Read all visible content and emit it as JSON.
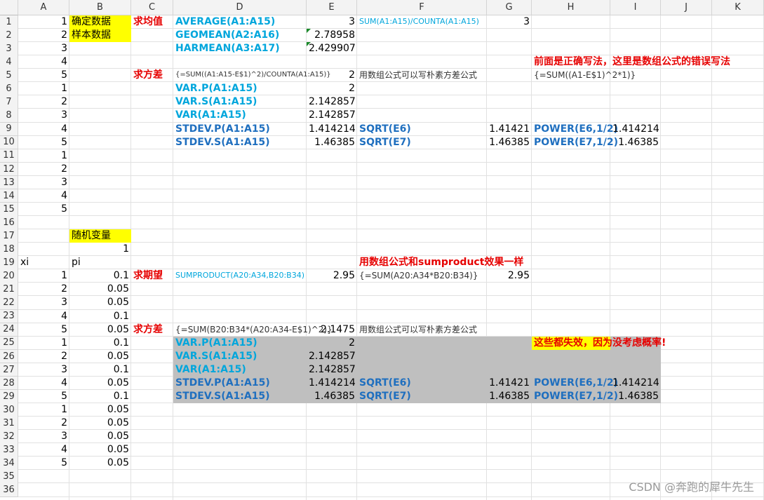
{
  "sheet": {
    "columns": [
      "A",
      "B",
      "C",
      "D",
      "E",
      "F",
      "G",
      "H",
      "I",
      "J",
      "K"
    ],
    "row_count": 36
  },
  "colors": {
    "yellow": "#ffff00",
    "gray": "#bfbfbf",
    "formula_blue": "#00a6dc",
    "dark_blue": "#1f6fbf",
    "red": "#e60000"
  },
  "cells": [
    {
      "r": 1,
      "c": "A",
      "v": "1",
      "t": "num"
    },
    {
      "r": 2,
      "c": "A",
      "v": "2",
      "t": "num"
    },
    {
      "r": 3,
      "c": "A",
      "v": "3",
      "t": "num"
    },
    {
      "r": 4,
      "c": "A",
      "v": "4",
      "t": "num"
    },
    {
      "r": 5,
      "c": "A",
      "v": "5",
      "t": "num"
    },
    {
      "r": 6,
      "c": "A",
      "v": "1",
      "t": "num"
    },
    {
      "r": 7,
      "c": "A",
      "v": "2",
      "t": "num"
    },
    {
      "r": 8,
      "c": "A",
      "v": "3",
      "t": "num"
    },
    {
      "r": 9,
      "c": "A",
      "v": "4",
      "t": "num"
    },
    {
      "r": 10,
      "c": "A",
      "v": "5",
      "t": "num"
    },
    {
      "r": 11,
      "c": "A",
      "v": "1",
      "t": "num"
    },
    {
      "r": 12,
      "c": "A",
      "v": "2",
      "t": "num"
    },
    {
      "r": 13,
      "c": "A",
      "v": "3",
      "t": "num"
    },
    {
      "r": 14,
      "c": "A",
      "v": "4",
      "t": "num"
    },
    {
      "r": 15,
      "c": "A",
      "v": "5",
      "t": "num"
    },
    {
      "r": 1,
      "c": "B",
      "v": "确定数据",
      "t": "text"
    },
    {
      "r": 2,
      "c": "B",
      "v": "样本数据",
      "t": "text"
    },
    {
      "r": 1,
      "c": "C",
      "v": "求均值",
      "t": "red"
    },
    {
      "r": 1,
      "c": "D",
      "v": "AVERAGE(A1:A15)",
      "t": "blue"
    },
    {
      "r": 2,
      "c": "D",
      "v": "GEOMEAN(A2:A16)",
      "t": "blue"
    },
    {
      "r": 3,
      "c": "D",
      "v": "HARMEAN(A3:A17)",
      "t": "blue"
    },
    {
      "r": 1,
      "c": "E",
      "v": "3",
      "t": "num"
    },
    {
      "r": 2,
      "c": "E",
      "v": "2.78958",
      "t": "num"
    },
    {
      "r": 3,
      "c": "E",
      "v": "2.429907",
      "t": "num"
    },
    {
      "r": 1,
      "c": "F",
      "v": "SUM(A1:A15)/COUNTA(A1:A15)",
      "t": "blue_small"
    },
    {
      "r": 1,
      "c": "G",
      "v": "3",
      "t": "num"
    },
    {
      "r": 4,
      "c": "H",
      "v": "前面是正确写法，这里是数组公式的错误写法",
      "t": "red"
    },
    {
      "r": 5,
      "c": "C",
      "v": "求方差",
      "t": "red"
    },
    {
      "r": 5,
      "c": "D",
      "v": "{=SUM((A1:A15-E$1)^2)/COUNTA(A1:A15)}",
      "t": "small"
    },
    {
      "r": 5,
      "c": "E",
      "v": "2",
      "t": "num"
    },
    {
      "r": 5,
      "c": "F",
      "v": "用数组公式可以写朴素方差公式",
      "t": "note"
    },
    {
      "r": 5,
      "c": "H",
      "v": "{=SUM((A1-E$1)^2*1)}",
      "t": "note"
    },
    {
      "r": 6,
      "c": "D",
      "v": "VAR.P(A1:A15)",
      "t": "blue"
    },
    {
      "r": 7,
      "c": "D",
      "v": "VAR.S(A1:A15)",
      "t": "blue"
    },
    {
      "r": 8,
      "c": "D",
      "v": "VAR(A1:A15)",
      "t": "blue"
    },
    {
      "r": 9,
      "c": "D",
      "v": "STDEV.P(A1:A15)",
      "t": "dblue"
    },
    {
      "r": 10,
      "c": "D",
      "v": "STDEV.S(A1:A15)",
      "t": "dblue"
    },
    {
      "r": 6,
      "c": "E",
      "v": "2",
      "t": "num"
    },
    {
      "r": 7,
      "c": "E",
      "v": "2.142857",
      "t": "num"
    },
    {
      "r": 8,
      "c": "E",
      "v": "2.142857",
      "t": "num"
    },
    {
      "r": 9,
      "c": "E",
      "v": "1.414214",
      "t": "num"
    },
    {
      "r": 10,
      "c": "E",
      "v": "1.46385",
      "t": "num"
    },
    {
      "r": 9,
      "c": "F",
      "v": "SQRT(E6)",
      "t": "dblue"
    },
    {
      "r": 10,
      "c": "F",
      "v": "SQRT(E7)",
      "t": "dblue"
    },
    {
      "r": 9,
      "c": "G",
      "v": "1.41421",
      "t": "num"
    },
    {
      "r": 10,
      "c": "G",
      "v": "1.46385",
      "t": "num"
    },
    {
      "r": 9,
      "c": "H",
      "v": "POWER(E6,1/2)",
      "t": "dblue"
    },
    {
      "r": 10,
      "c": "H",
      "v": "POWER(E7,1/2)",
      "t": "dblue"
    },
    {
      "r": 9,
      "c": "I",
      "v": "1.414214",
      "t": "num"
    },
    {
      "r": 10,
      "c": "I",
      "v": "1.46385",
      "t": "num"
    },
    {
      "r": 17,
      "c": "B",
      "v": "随机变量",
      "t": "text"
    },
    {
      "r": 18,
      "c": "B",
      "v": "1",
      "t": "num"
    },
    {
      "r": 19,
      "c": "A",
      "v": "xi",
      "t": "text"
    },
    {
      "r": 19,
      "c": "B",
      "v": "pi",
      "t": "text"
    },
    {
      "r": 19,
      "c": "F",
      "v": "用数组公式和sumproduct效果一样",
      "t": "red"
    },
    {
      "r": 20,
      "c": "A",
      "v": "1",
      "t": "num"
    },
    {
      "r": 21,
      "c": "A",
      "v": "2",
      "t": "num"
    },
    {
      "r": 22,
      "c": "A",
      "v": "3",
      "t": "num"
    },
    {
      "r": 23,
      "c": "A",
      "v": "4",
      "t": "num"
    },
    {
      "r": 24,
      "c": "A",
      "v": "5",
      "t": "num"
    },
    {
      "r": 25,
      "c": "A",
      "v": "1",
      "t": "num"
    },
    {
      "r": 26,
      "c": "A",
      "v": "2",
      "t": "num"
    },
    {
      "r": 27,
      "c": "A",
      "v": "3",
      "t": "num"
    },
    {
      "r": 28,
      "c": "A",
      "v": "4",
      "t": "num"
    },
    {
      "r": 29,
      "c": "A",
      "v": "5",
      "t": "num"
    },
    {
      "r": 30,
      "c": "A",
      "v": "1",
      "t": "num"
    },
    {
      "r": 31,
      "c": "A",
      "v": "2",
      "t": "num"
    },
    {
      "r": 32,
      "c": "A",
      "v": "3",
      "t": "num"
    },
    {
      "r": 33,
      "c": "A",
      "v": "4",
      "t": "num"
    },
    {
      "r": 34,
      "c": "A",
      "v": "5",
      "t": "num"
    },
    {
      "r": 20,
      "c": "B",
      "v": "0.1",
      "t": "num"
    },
    {
      "r": 21,
      "c": "B",
      "v": "0.05",
      "t": "num"
    },
    {
      "r": 22,
      "c": "B",
      "v": "0.05",
      "t": "num"
    },
    {
      "r": 23,
      "c": "B",
      "v": "0.1",
      "t": "num"
    },
    {
      "r": 24,
      "c": "B",
      "v": "0.05",
      "t": "num"
    },
    {
      "r": 25,
      "c": "B",
      "v": "0.1",
      "t": "num"
    },
    {
      "r": 26,
      "c": "B",
      "v": "0.05",
      "t": "num"
    },
    {
      "r": 27,
      "c": "B",
      "v": "0.1",
      "t": "num"
    },
    {
      "r": 28,
      "c": "B",
      "v": "0.05",
      "t": "num"
    },
    {
      "r": 29,
      "c": "B",
      "v": "0.1",
      "t": "num"
    },
    {
      "r": 30,
      "c": "B",
      "v": "0.05",
      "t": "num"
    },
    {
      "r": 31,
      "c": "B",
      "v": "0.05",
      "t": "num"
    },
    {
      "r": 32,
      "c": "B",
      "v": "0.05",
      "t": "num"
    },
    {
      "r": 33,
      "c": "B",
      "v": "0.05",
      "t": "num"
    },
    {
      "r": 34,
      "c": "B",
      "v": "0.05",
      "t": "num"
    },
    {
      "r": 20,
      "c": "C",
      "v": "求期望",
      "t": "red"
    },
    {
      "r": 20,
      "c": "D",
      "v": "SUMPRODUCT(A20:A34,B20:B34)",
      "t": "blue_small"
    },
    {
      "r": 20,
      "c": "E",
      "v": "2.95",
      "t": "num"
    },
    {
      "r": 20,
      "c": "F",
      "v": "{=SUM(A20:A34*B20:B34)}",
      "t": "note"
    },
    {
      "r": 20,
      "c": "G",
      "v": "2.95",
      "t": "num"
    },
    {
      "r": 24,
      "c": "C",
      "v": "求方差",
      "t": "red"
    },
    {
      "r": 24,
      "c": "D",
      "v": "{=SUM(B20:B34*(A20:A34-E$1)^2)}",
      "t": "note"
    },
    {
      "r": 24,
      "c": "E",
      "v": "2.1475",
      "t": "num"
    },
    {
      "r": 24,
      "c": "F",
      "v": "用数组公式可以写朴素方差公式",
      "t": "note"
    },
    {
      "r": 25,
      "c": "H",
      "v": "这些都失效，因为没考虑概率!",
      "t": "red"
    },
    {
      "r": 25,
      "c": "D",
      "v": "VAR.P(A1:A15)",
      "t": "blue"
    },
    {
      "r": 26,
      "c": "D",
      "v": "VAR.S(A1:A15)",
      "t": "blue"
    },
    {
      "r": 27,
      "c": "D",
      "v": "VAR(A1:A15)",
      "t": "blue"
    },
    {
      "r": 28,
      "c": "D",
      "v": "STDEV.P(A1:A15)",
      "t": "dblue"
    },
    {
      "r": 29,
      "c": "D",
      "v": "STDEV.S(A1:A15)",
      "t": "dblue"
    },
    {
      "r": 25,
      "c": "E",
      "v": "2",
      "t": "num"
    },
    {
      "r": 26,
      "c": "E",
      "v": "2.142857",
      "t": "num"
    },
    {
      "r": 27,
      "c": "E",
      "v": "2.142857",
      "t": "num"
    },
    {
      "r": 28,
      "c": "E",
      "v": "1.414214",
      "t": "num"
    },
    {
      "r": 29,
      "c": "E",
      "v": "1.46385",
      "t": "num"
    },
    {
      "r": 28,
      "c": "F",
      "v": "SQRT(E6)",
      "t": "dblue"
    },
    {
      "r": 29,
      "c": "F",
      "v": "SQRT(E7)",
      "t": "dblue"
    },
    {
      "r": 28,
      "c": "G",
      "v": "1.41421",
      "t": "num"
    },
    {
      "r": 29,
      "c": "G",
      "v": "1.46385",
      "t": "num"
    },
    {
      "r": 28,
      "c": "H",
      "v": "POWER(E6,1/2)",
      "t": "dblue"
    },
    {
      "r": 29,
      "c": "H",
      "v": "POWER(E7,1/2)",
      "t": "dblue"
    },
    {
      "r": 28,
      "c": "I",
      "v": "1.414214",
      "t": "num"
    },
    {
      "r": 29,
      "c": "I",
      "v": "1.46385",
      "t": "num"
    }
  ],
  "fills": [
    {
      "r1": 1,
      "r2": 2,
      "c1": "B",
      "c2": "B",
      "color": "yellow"
    },
    {
      "r1": 17,
      "r2": 17,
      "c1": "B",
      "c2": "B",
      "color": "yellow"
    },
    {
      "r1": 25,
      "r2": 25,
      "c1": "H",
      "c2": "H",
      "color": "yellow"
    },
    {
      "r1": 25,
      "r2": 29,
      "c1": "D",
      "c2": "G",
      "color": "gray"
    },
    {
      "r1": 26,
      "r2": 29,
      "c1": "H",
      "c2": "I",
      "color": "gray"
    },
    {
      "r1": 25,
      "r2": 25,
      "c1": "I",
      "c2": "I",
      "color": "gray"
    }
  ],
  "error_markers": [
    {
      "r": 2,
      "c": "E"
    },
    {
      "r": 3,
      "c": "E"
    }
  ],
  "watermark": "CSDN @奔跑的犀牛先生"
}
